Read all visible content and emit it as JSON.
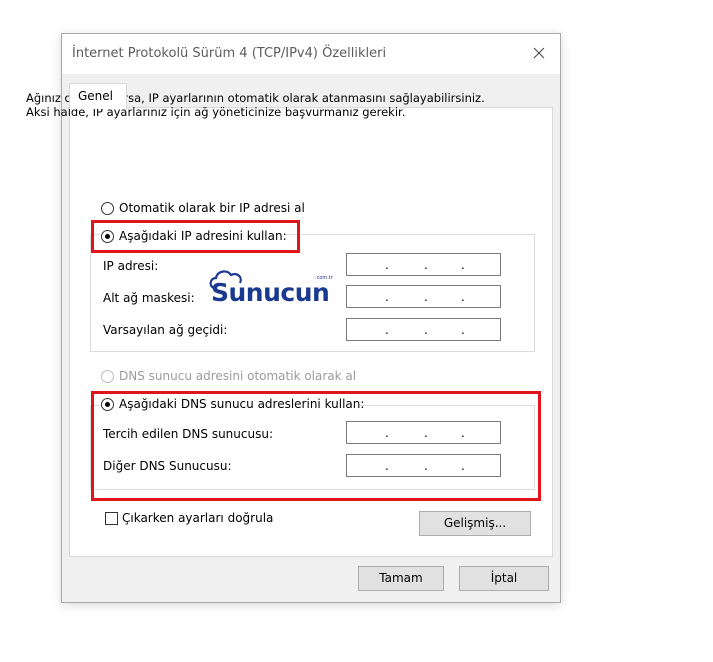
{
  "dialog": {
    "title": "İnternet Protokolü Sürüm 4 (TCP/IPv4) Özellikleri"
  },
  "tabs": [
    {
      "label": "Genel"
    }
  ],
  "description": "Ağınız destekliyorsa, IP ayarlarının otomatik olarak atanmasını sağlayabilirsiniz. Aksi halde, IP ayarlarınız için ağ yöneticinize başvurmanız gerekir.",
  "ip": {
    "auto_label": "Otomatik olarak bir IP adresi al",
    "manual_label": "Aşağıdaki IP adresini kullan:",
    "selected": "manual",
    "fields": [
      {
        "label": "IP adresi:"
      },
      {
        "label": "Alt ağ maskesi:"
      },
      {
        "label": "Varsayılan ağ geçidi:"
      }
    ]
  },
  "dns": {
    "auto_label": "DNS sunucu adresini otomatik olarak al",
    "manual_label": "Aşağıdaki DNS sunucu adreslerini kullan:",
    "selected": "manual",
    "fields": [
      {
        "label": "Tercih edilen DNS sunucusu:"
      },
      {
        "label": "Diğer DNS Sunucusu:"
      }
    ]
  },
  "validate": {
    "label": "Çıkarken ayarları doğrula",
    "checked": false
  },
  "buttons": {
    "advanced": "Gelişmiş...",
    "ok": "Tamam",
    "cancel": "İptal"
  },
  "ip_separator": ".",
  "watermark": {
    "text": "Sunucun",
    "small": ".com.tr"
  },
  "colors": {
    "highlight": "#e0141b",
    "watermark": "#1a3a8f"
  }
}
